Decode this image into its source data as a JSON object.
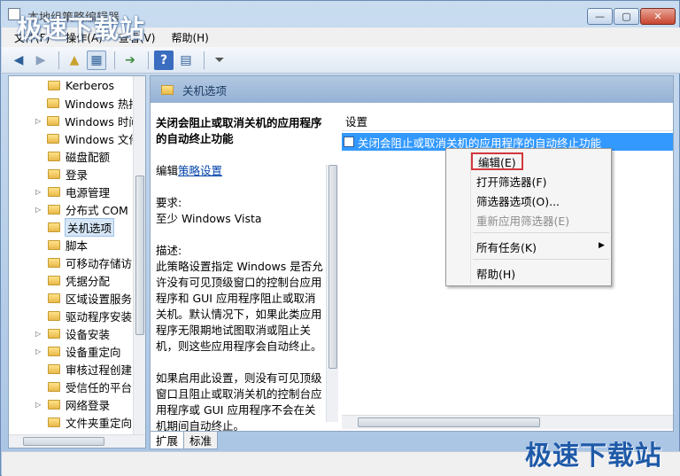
{
  "window": {
    "title": "本地组策略编辑器",
    "minimize_label": "—",
    "maximize_label": "▢",
    "close_label": "✕"
  },
  "watermark": {
    "top_left": "极速下载站",
    "bottom_right": "极速下载站"
  },
  "menubar": {
    "items": [
      "文件(F)",
      "操作(A)",
      "查看(V)",
      "帮助(H)"
    ]
  },
  "toolbar": {
    "icons": [
      "back-icon",
      "forward-icon",
      "up-folder-icon",
      "show-hide-tree-icon",
      "export-list-icon",
      "help-icon",
      "properties-icon",
      "filter-icon"
    ]
  },
  "tree": {
    "items": [
      {
        "label": "Kerberos",
        "expandable": false
      },
      {
        "label": "Windows 热插",
        "expandable": false
      },
      {
        "label": "Windows 时间",
        "expandable": true
      },
      {
        "label": "Windows 文件",
        "expandable": false
      },
      {
        "label": "磁盘配额",
        "expandable": false
      },
      {
        "label": "登录",
        "expandable": false
      },
      {
        "label": "电源管理",
        "expandable": true
      },
      {
        "label": "分布式 COM",
        "expandable": true
      },
      {
        "label": "关机选项",
        "expandable": false,
        "selected": true
      },
      {
        "label": "脚本",
        "expandable": false
      },
      {
        "label": "可移动存储访",
        "expandable": false
      },
      {
        "label": "凭据分配",
        "expandable": false
      },
      {
        "label": "区域设置服务",
        "expandable": false
      },
      {
        "label": "驱动程序安装",
        "expandable": false
      },
      {
        "label": "设备安装",
        "expandable": true
      },
      {
        "label": "设备重定向",
        "expandable": true
      },
      {
        "label": "审核过程创建",
        "expandable": false
      },
      {
        "label": "受信任的平台",
        "expandable": false
      },
      {
        "label": "网络登录",
        "expandable": true
      },
      {
        "label": "文件夹重定向",
        "expandable": false
      }
    ]
  },
  "right_pane": {
    "header_title": "关机选项",
    "description": {
      "title": "关闭会阻止或取消关机的应用程序的自动终止功能",
      "edit_prefix": "编辑",
      "edit_link": "策略设置",
      "requirements_label": "要求:",
      "requirements_value": "至少 Windows Vista",
      "desc_label": "描述:",
      "desc_text": "此策略设置指定 Windows 是否允许没有可见顶级窗口的控制台应用程序和 GUI 应用程序阻止或取消关机。默认情况下，如果此类应用程序无限期地试图取消或阻止关机，则这些应用程序会自动终止。",
      "desc_text2": "如果启用此设置，则没有可见顶级窗口且阻止或取消关机的控制台应用程序或 GUI 应用程序不会在关机期间自动终止。"
    },
    "list_header": "设置",
    "list_rows": [
      "关闭会阻止或取消关机的应用程序的自动终止功能"
    ]
  },
  "tabs": [
    "扩展",
    "标准"
  ],
  "context_menu": {
    "items": [
      {
        "label": "编辑(E)",
        "highlight": true,
        "disabled": false
      },
      {
        "label": "打开筛选器(F)",
        "disabled": false
      },
      {
        "label": "筛选器选项(O)...",
        "disabled": false
      },
      {
        "label": "重新应用筛选器(E)",
        "disabled": true
      },
      {
        "label": "所有任务(K)",
        "disabled": false,
        "submenu": true
      },
      {
        "label": "帮助(H)",
        "disabled": false
      }
    ],
    "submenu_arrow": "▶"
  }
}
